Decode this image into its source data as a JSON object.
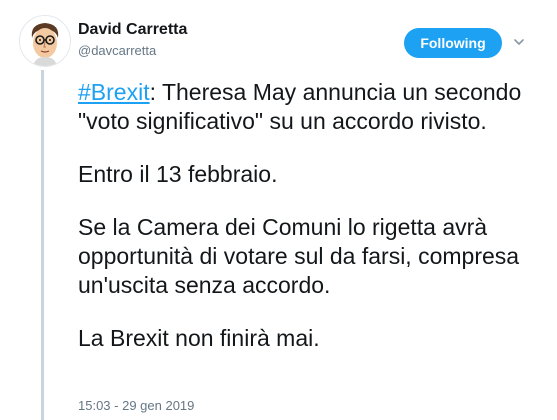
{
  "author": {
    "display_name": "David Carretta",
    "handle": "@davcarretta",
    "avatar_icon": "caricature-portrait-avatar"
  },
  "follow_button": {
    "label": "Following",
    "color": "#1da1f2"
  },
  "menu": {
    "icon": "chevron-down-icon"
  },
  "tweet": {
    "hashtag": "#Brexit",
    "line1_rest": ": Theresa May annuncia un secondo \"voto significativo\" su un accordo rivisto.",
    "para2": "Entro il 13 febbraio.",
    "para3": "Se la Camera dei Comuni lo rigetta avrà opportunità di votare sul da farsi, compresa un'uscita senza accordo.",
    "para4": "La Brexit non finirà mai.",
    "link_color": "#1da1f2"
  },
  "timestamp": "15:03 - 29 gen 2019"
}
